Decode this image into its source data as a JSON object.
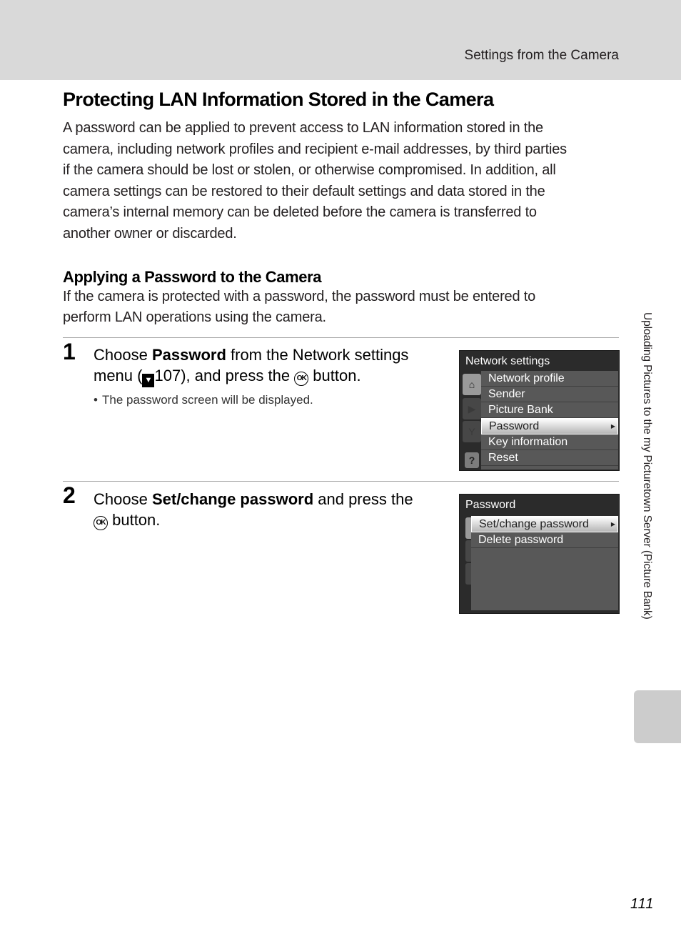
{
  "header": {
    "section_title": "Settings from the Camera"
  },
  "heading": "Protecting LAN Information Stored in the Camera",
  "intro_lines": [
    "A password can be applied to prevent access to LAN information stored in the",
    "camera, including network profiles and recipient e-mail addresses, by third parties",
    "if the camera should be lost or stolen, or otherwise compromised. In addition, all",
    "camera settings can be restored to their default settings and data stored in the",
    "camera’s internal memory can be deleted before the camera is transferred to",
    "another owner or discarded."
  ],
  "subheading": "Applying a Password to the Camera",
  "sub_lines": [
    "If the camera is protected with a password, the password must be entered to",
    "perform LAN operations using the camera."
  ],
  "steps": [
    {
      "number": "1",
      "text_pre": "Choose ",
      "text_bold": "Password",
      "text_mid": " from the Network settings",
      "text_line2_pre": "menu (",
      "ref_page": "107",
      "text_line2_mid": "), and press the ",
      "ok_label": "OK",
      "text_end": " button.",
      "bullet": "The password screen will be displayed."
    },
    {
      "number": "2",
      "text_pre": "Choose ",
      "text_bold": "Set/change password",
      "text_mid": " and press the",
      "ok_label": "OK",
      "text_end": " button."
    }
  ],
  "screen1": {
    "title": "Network settings",
    "tab_icons": [
      "network-icon",
      "playback-icon",
      "setup-wrench-icon",
      "help-icon"
    ],
    "items": [
      "Network profile",
      "Sender",
      "Picture Bank",
      "Password",
      "Key information",
      "Reset"
    ],
    "selected_index": 3
  },
  "screen2": {
    "title": "Password",
    "items": [
      "Set/change password",
      "Delete password"
    ],
    "selected_index": 0
  },
  "side_tab_text": "Uploading Pictures to the my Picturetown Server (Picture Bank)",
  "page_number": "111"
}
